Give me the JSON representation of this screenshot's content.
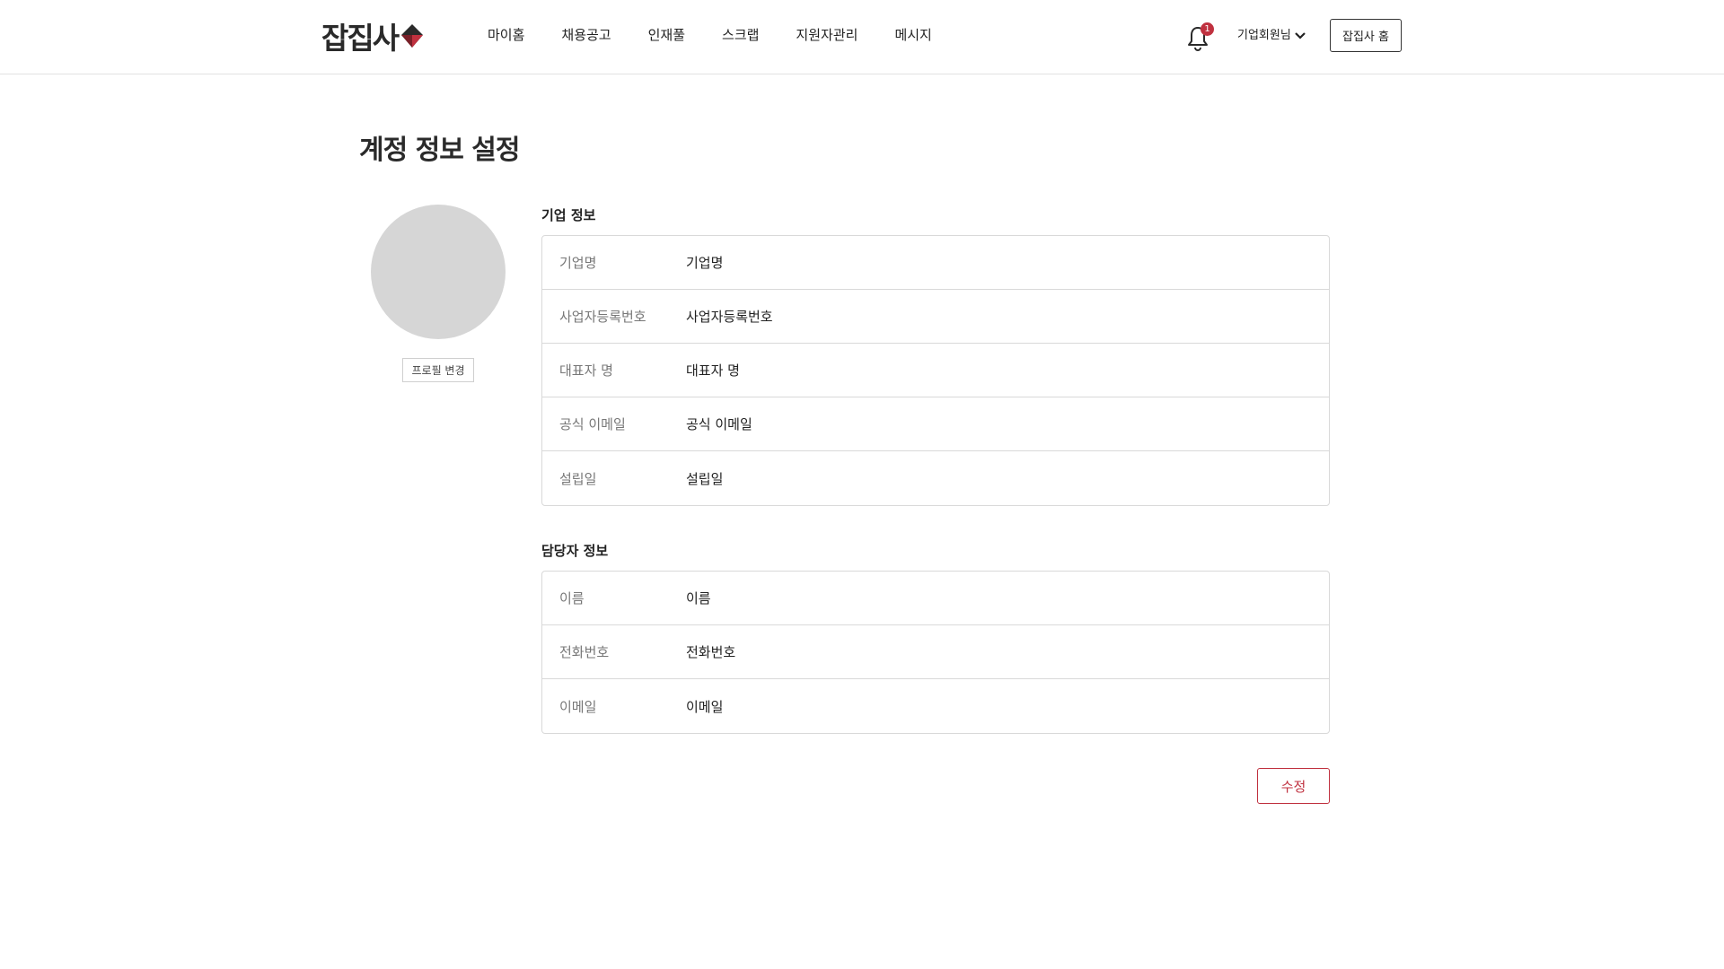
{
  "header": {
    "logo_text": "잡집사",
    "nav": [
      {
        "label": "마이홈"
      },
      {
        "label": "채용공고"
      },
      {
        "label": "인재풀"
      },
      {
        "label": "스크랩"
      },
      {
        "label": "지원자관리"
      },
      {
        "label": "메시지"
      }
    ],
    "notification_count": "1",
    "user_label": "기업회원님",
    "home_button_label": "잡집사 홈"
  },
  "page": {
    "title": "계정 정보 설정",
    "profile_button_label": "프로필 변경"
  },
  "company_section": {
    "title": "기업 정보",
    "rows": [
      {
        "label": "기업명",
        "value": "기업명"
      },
      {
        "label": "사업자등록번호",
        "value": "사업자등록번호"
      },
      {
        "label": "대표자 명",
        "value": "대표자 명"
      },
      {
        "label": "공식 이메일",
        "value": "공식 이메일"
      },
      {
        "label": "설립일",
        "value": "설립일"
      }
    ]
  },
  "manager_section": {
    "title": "담당자 정보",
    "rows": [
      {
        "label": "이름",
        "value": "이름"
      },
      {
        "label": "전화번호",
        "value": "전화번호"
      },
      {
        "label": "이메일",
        "value": "이메일"
      }
    ]
  },
  "edit_button_label": "수정",
  "colors": {
    "accent": "#c0313f",
    "border": "#d9d9d9",
    "avatar_placeholder": "#d6d6d6",
    "label_text": "#777777"
  },
  "icons": {
    "logo_mark": "diamond-logo-icon",
    "notification": "bell-icon",
    "user_menu": "chevron-down-icon"
  }
}
